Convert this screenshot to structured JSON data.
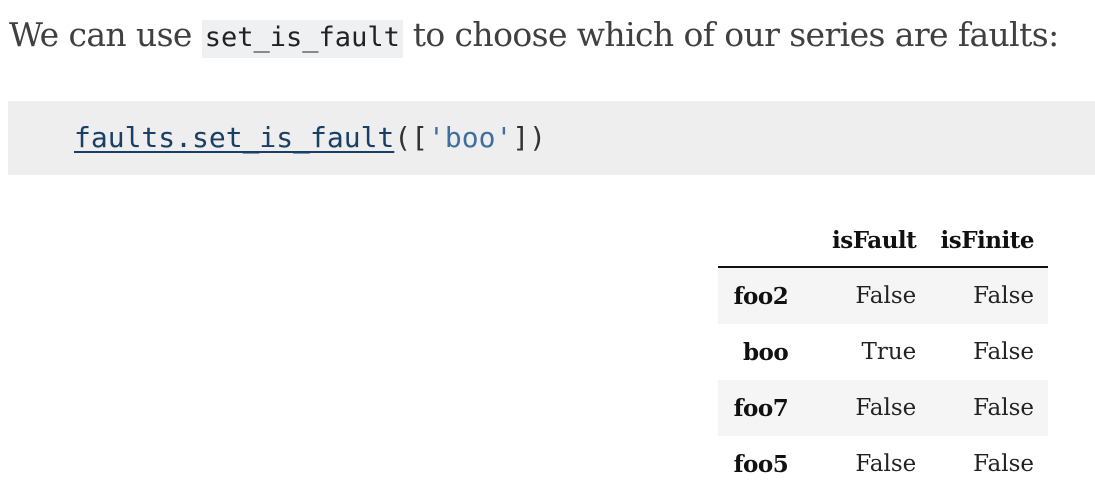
{
  "intro": {
    "before": "We can use ",
    "code": "set_is_fault",
    "after": " to choose which of our series are faults:"
  },
  "code_cell": {
    "call": "faults.set_is_fault",
    "open": "([",
    "arg": "'boo'",
    "close": "])"
  },
  "table": {
    "index_header": "",
    "columns": [
      "isFault",
      "isFinite"
    ],
    "rows": [
      {
        "index": "foo2",
        "isFault": "False",
        "isFinite": "False"
      },
      {
        "index": "boo",
        "isFault": "True",
        "isFinite": "False"
      },
      {
        "index": "foo7",
        "isFault": "False",
        "isFinite": "False"
      },
      {
        "index": "foo5",
        "isFault": "False",
        "isFinite": "False"
      }
    ]
  }
}
